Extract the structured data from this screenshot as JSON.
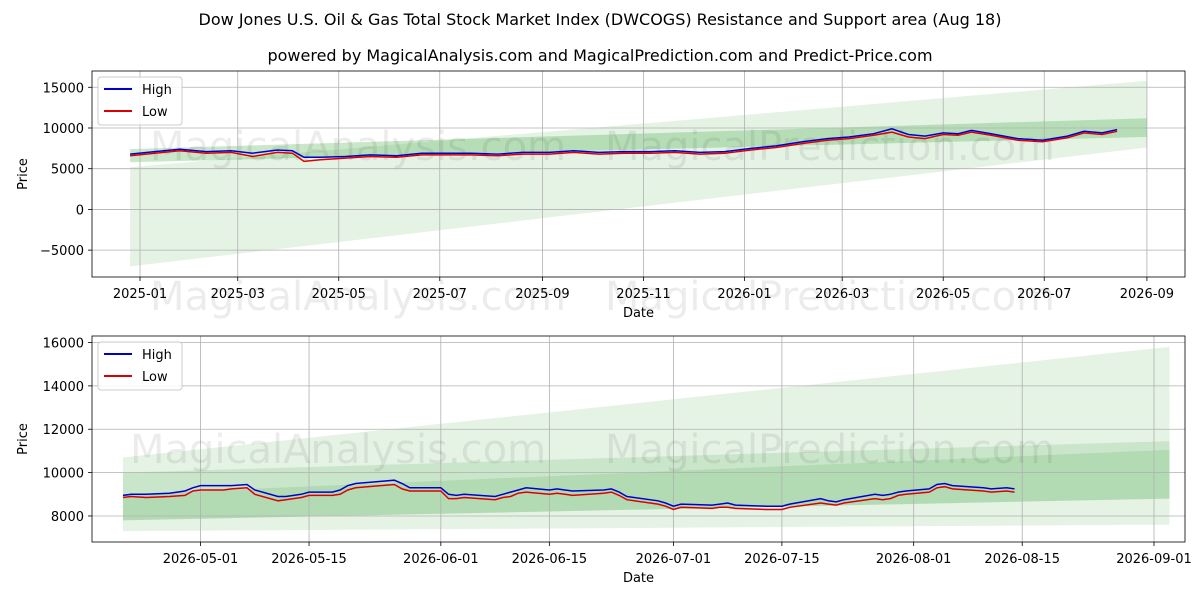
{
  "title": "Dow Jones U.S. Oil & Gas Total Stock Market Index (DWCOGS) Resistance and Support area (Aug 18)",
  "subtitle": "powered by MagicalAnalysis.com and MagicalPrediction.com and Predict-Price.com",
  "watermarks": [
    "MagicalAnalysis.com",
    "MagicalPrediction.com"
  ],
  "colors": {
    "high": "#0000cc",
    "low": "#dd0000",
    "band": "#2ca02c",
    "grid": "#b0b0b0"
  },
  "chart_data": [
    {
      "type": "line",
      "xlabel": "Date",
      "ylabel": "Price",
      "x_ticks": [
        "2025-01",
        "2025-03",
        "2025-05",
        "2025-07",
        "2025-09",
        "2025-11",
        "2026-01",
        "2026-03",
        "2026-05",
        "2026-07",
        "2026-09"
      ],
      "y_ticks": [
        "−5000",
        "0",
        "5000",
        "10000",
        "15000"
      ],
      "xlim": [
        "2024-12-03",
        "2026-09-24"
      ],
      "ylim": [
        -8300,
        17000
      ],
      "grid": true,
      "legend": "upper left",
      "bands": [
        {
          "start": "2024-12-26",
          "end": "2026-09-01",
          "low_start": -7000,
          "low_end": 7600,
          "high_start": 5200,
          "high_end": 15800,
          "opacity": 0.12
        },
        {
          "start": "2024-12-26",
          "end": "2026-09-01",
          "low_start": 5800,
          "low_end": 8900,
          "high_start": 7400,
          "high_end": 11200,
          "opacity": 0.25
        }
      ],
      "series": [
        {
          "name": "High",
          "x": [
            "2024-12-26",
            "2025-01-10",
            "2025-01-25",
            "2025-02-10",
            "2025-02-25",
            "2025-03-10",
            "2025-03-25",
            "2025-04-03",
            "2025-04-10",
            "2025-04-20",
            "2025-05-05",
            "2025-05-20",
            "2025-06-05",
            "2025-06-20",
            "2025-07-05",
            "2025-07-20",
            "2025-08-05",
            "2025-08-20",
            "2025-09-05",
            "2025-09-20",
            "2025-10-05",
            "2025-10-20",
            "2025-11-05",
            "2025-11-20",
            "2025-12-05",
            "2025-12-20",
            "2026-01-05",
            "2026-01-20",
            "2026-02-05",
            "2026-02-20",
            "2026-03-05",
            "2026-03-20",
            "2026-03-31",
            "2026-04-10",
            "2026-04-20",
            "2026-05-01",
            "2026-05-10",
            "2026-05-18",
            "2026-05-30",
            "2026-06-15",
            "2026-06-30",
            "2026-07-15",
            "2026-07-25",
            "2026-08-05",
            "2026-08-14"
          ],
          "y": [
            6800,
            7100,
            7400,
            7100,
            7200,
            6900,
            7300,
            7200,
            6400,
            6400,
            6500,
            6700,
            6600,
            6900,
            6900,
            6900,
            6800,
            7000,
            7000,
            7200,
            7000,
            7100,
            7100,
            7200,
            7000,
            7100,
            7500,
            7800,
            8300,
            8700,
            8900,
            9300,
            9900,
            9200,
            9000,
            9400,
            9300,
            9700,
            9300,
            8700,
            8500,
            9000,
            9600,
            9400,
            9800
          ]
        },
        {
          "name": "Low",
          "x": [
            "2024-12-26",
            "2025-01-10",
            "2025-01-25",
            "2025-02-10",
            "2025-02-25",
            "2025-03-10",
            "2025-03-25",
            "2025-04-03",
            "2025-04-10",
            "2025-04-20",
            "2025-05-05",
            "2025-05-20",
            "2025-06-05",
            "2025-06-20",
            "2025-07-05",
            "2025-07-20",
            "2025-08-05",
            "2025-08-20",
            "2025-09-05",
            "2025-09-20",
            "2025-10-05",
            "2025-10-20",
            "2025-11-05",
            "2025-11-20",
            "2025-12-05",
            "2025-12-20",
            "2026-01-05",
            "2026-01-20",
            "2026-02-05",
            "2026-02-20",
            "2026-03-05",
            "2026-03-20",
            "2026-03-31",
            "2026-04-10",
            "2026-04-20",
            "2026-05-01",
            "2026-05-10",
            "2026-05-18",
            "2026-05-30",
            "2026-06-15",
            "2026-06-30",
            "2026-07-15",
            "2026-07-25",
            "2026-08-05",
            "2026-08-14"
          ],
          "y": [
            6600,
            6900,
            7200,
            6900,
            7000,
            6500,
            7000,
            6900,
            5900,
            6100,
            6300,
            6500,
            6400,
            6700,
            6700,
            6700,
            6600,
            6800,
            6800,
            7000,
            6800,
            6900,
            6900,
            7000,
            6800,
            6900,
            7300,
            7600,
            8100,
            8500,
            8700,
            9100,
            9500,
            8900,
            8700,
            9200,
            9100,
            9500,
            9100,
            8500,
            8300,
            8800,
            9400,
            9200,
            9600
          ]
        }
      ]
    },
    {
      "type": "line",
      "xlabel": "Date",
      "ylabel": "Price",
      "x_ticks": [
        "2026-05-01",
        "2026-05-15",
        "2026-06-01",
        "2026-06-15",
        "2026-07-01",
        "2026-07-15",
        "2026-08-01",
        "2026-08-15",
        "2026-09-01"
      ],
      "y_ticks": [
        "8000",
        "10000",
        "12000",
        "14000",
        "16000"
      ],
      "xlim": [
        "2026-04-17",
        "2026-09-05"
      ],
      "ylim": [
        6800,
        16300
      ],
      "grid": true,
      "legend": "upper left",
      "bands": [
        {
          "start": "2026-04-21",
          "end": "2026-09-03",
          "low_start": 7300,
          "low_end": 7600,
          "high_start": 10700,
          "high_end": 15800,
          "opacity": 0.12
        },
        {
          "start": "2026-04-21",
          "end": "2026-09-03",
          "low_start": 7800,
          "low_end": 8800,
          "high_start": 10000,
          "high_end": 11450,
          "opacity": 0.15
        },
        {
          "start": "2026-04-21",
          "end": "2026-09-03",
          "low_start": 7800,
          "low_end": 8800,
          "high_start": 9000,
          "high_end": 11050,
          "opacity": 0.15
        }
      ],
      "series": [
        {
          "name": "High",
          "x": [
            "2026-04-21",
            "2026-04-22",
            "2026-04-24",
            "2026-04-27",
            "2026-04-29",
            "2026-04-30",
            "2026-05-01",
            "2026-05-04",
            "2026-05-05",
            "2026-05-07",
            "2026-05-08",
            "2026-05-11",
            "2026-05-12",
            "2026-05-13",
            "2026-05-14",
            "2026-05-15",
            "2026-05-18",
            "2026-05-19",
            "2026-05-20",
            "2026-05-21",
            "2026-05-26",
            "2026-05-27",
            "2026-05-28",
            "2026-05-29",
            "2026-06-01",
            "2026-06-02",
            "2026-06-03",
            "2026-06-04",
            "2026-06-08",
            "2026-06-09",
            "2026-06-10",
            "2026-06-11",
            "2026-06-12",
            "2026-06-15",
            "2026-06-16",
            "2026-06-17",
            "2026-06-18",
            "2026-06-22",
            "2026-06-23",
            "2026-06-24",
            "2026-06-25",
            "2026-06-29",
            "2026-06-30",
            "2026-07-01",
            "2026-07-02",
            "2026-07-06",
            "2026-07-07",
            "2026-07-08",
            "2026-07-09",
            "2026-07-13",
            "2026-07-14",
            "2026-07-15",
            "2026-07-16",
            "2026-07-20",
            "2026-07-21",
            "2026-07-22",
            "2026-07-23",
            "2026-07-27",
            "2026-07-28",
            "2026-07-29",
            "2026-07-30",
            "2026-07-31",
            "2026-08-03",
            "2026-08-04",
            "2026-08-05",
            "2026-08-06",
            "2026-08-10",
            "2026-08-11",
            "2026-08-13",
            "2026-08-14"
          ],
          "y": [
            8950,
            9000,
            9000,
            9050,
            9150,
            9300,
            9400,
            9400,
            9400,
            9450,
            9200,
            8900,
            8900,
            8950,
            9000,
            9100,
            9100,
            9200,
            9400,
            9500,
            9650,
            9500,
            9300,
            9300,
            9300,
            9000,
            8950,
            9000,
            8900,
            9000,
            9100,
            9200,
            9300,
            9200,
            9250,
            9200,
            9150,
            9200,
            9250,
            9100,
            8900,
            8700,
            8600,
            8450,
            8550,
            8500,
            8550,
            8600,
            8500,
            8450,
            8450,
            8450,
            8550,
            8800,
            8700,
            8650,
            8750,
            9000,
            8950,
            9000,
            9100,
            9150,
            9250,
            9450,
            9500,
            9400,
            9300,
            9250,
            9300,
            9250
          ]
        },
        {
          "name": "Low",
          "x": [
            "2026-04-21",
            "2026-04-22",
            "2026-04-24",
            "2026-04-27",
            "2026-04-29",
            "2026-04-30",
            "2026-05-01",
            "2026-05-04",
            "2026-05-05",
            "2026-05-07",
            "2026-05-08",
            "2026-05-11",
            "2026-05-12",
            "2026-05-13",
            "2026-05-14",
            "2026-05-15",
            "2026-05-18",
            "2026-05-19",
            "2026-05-20",
            "2026-05-21",
            "2026-05-26",
            "2026-05-27",
            "2026-05-28",
            "2026-05-29",
            "2026-06-01",
            "2026-06-02",
            "2026-06-03",
            "2026-06-04",
            "2026-06-08",
            "2026-06-09",
            "2026-06-10",
            "2026-06-11",
            "2026-06-12",
            "2026-06-15",
            "2026-06-16",
            "2026-06-17",
            "2026-06-18",
            "2026-06-22",
            "2026-06-23",
            "2026-06-24",
            "2026-06-25",
            "2026-06-29",
            "2026-06-30",
            "2026-07-01",
            "2026-07-02",
            "2026-07-06",
            "2026-07-07",
            "2026-07-08",
            "2026-07-09",
            "2026-07-13",
            "2026-07-14",
            "2026-07-15",
            "2026-07-16",
            "2026-07-20",
            "2026-07-21",
            "2026-07-22",
            "2026-07-23",
            "2026-07-27",
            "2026-07-28",
            "2026-07-29",
            "2026-07-30",
            "2026-07-31",
            "2026-08-03",
            "2026-08-04",
            "2026-08-05",
            "2026-08-06",
            "2026-08-10",
            "2026-08-11",
            "2026-08-13",
            "2026-08-14"
          ],
          "y": [
            8850,
            8900,
            8850,
            8900,
            8950,
            9150,
            9200,
            9200,
            9250,
            9300,
            9000,
            8700,
            8750,
            8800,
            8850,
            8950,
            8950,
            9000,
            9200,
            9300,
            9450,
            9250,
            9150,
            9150,
            9150,
            8800,
            8800,
            8850,
            8750,
            8850,
            8900,
            9050,
            9100,
            9000,
            9050,
            9000,
            8950,
            9050,
            9100,
            8950,
            8750,
            8550,
            8450,
            8300,
            8400,
            8350,
            8400,
            8400,
            8350,
            8300,
            8300,
            8300,
            8400,
            8600,
            8550,
            8500,
            8600,
            8800,
            8750,
            8800,
            8950,
            9000,
            9100,
            9300,
            9350,
            9250,
            9150,
            9100,
            9150,
            9100
          ]
        }
      ]
    }
  ]
}
